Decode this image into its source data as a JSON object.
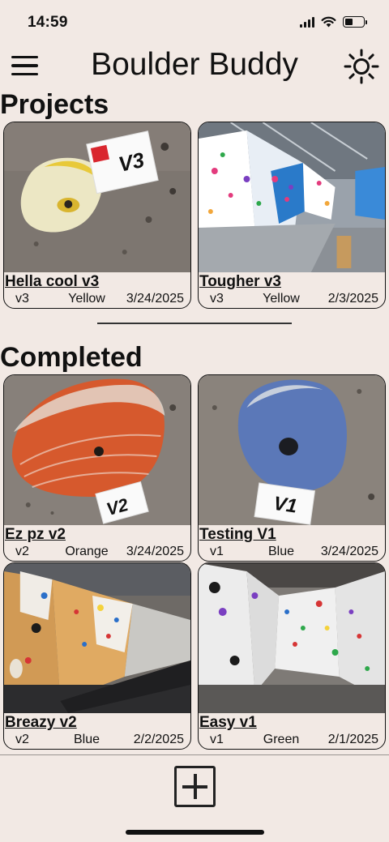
{
  "status_bar": {
    "time": "14:59"
  },
  "header": {
    "title": "Boulder Buddy"
  },
  "sections": {
    "projects": "Projects",
    "completed": "Completed"
  },
  "projects": [
    {
      "name": "Hella cool v3",
      "grade": "v3",
      "color": "Yellow",
      "date": "3/24/2025",
      "image": "yellow-hold",
      "tag": "V3"
    },
    {
      "name": "Tougher v3",
      "grade": "v3",
      "color": "Yellow",
      "date": "2/3/2025",
      "image": "gym-interior"
    }
  ],
  "completed": [
    {
      "name": "Ez pz v2",
      "grade": "v2",
      "color": "Orange",
      "date": "3/24/2025",
      "image": "orange-hold",
      "tag": "V2"
    },
    {
      "name": "Testing V1",
      "grade": "v1",
      "color": "Blue",
      "date": "3/24/2025",
      "image": "blue-hold",
      "tag": "V1"
    },
    {
      "name": "Breazy v2",
      "grade": "v2",
      "color": "Blue",
      "date": "2/2/2025",
      "image": "wood-wall"
    },
    {
      "name": "Easy v1",
      "grade": "v1",
      "color": "Green",
      "date": "2/1/2025",
      "image": "white-wall"
    }
  ],
  "icons": {
    "menu": "hamburger-menu-icon",
    "theme": "sun-icon",
    "add": "plus-square-icon"
  },
  "colors": {
    "background": "#f2e9e4",
    "text": "#111111"
  }
}
